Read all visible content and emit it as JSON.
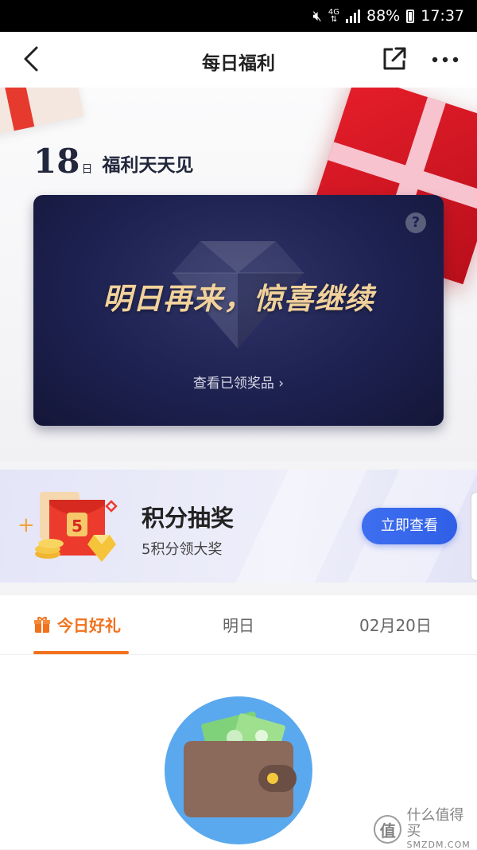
{
  "status_bar": {
    "network": "4G",
    "battery": "88%",
    "time": "17:37"
  },
  "nav": {
    "title": "每日福利"
  },
  "hero": {
    "day": "18",
    "day_unit": "日",
    "slogan": "福利天天见",
    "card": {
      "headline": "明日再来，惊喜继续",
      "help": "?",
      "link": "查看已领奖品"
    }
  },
  "points": {
    "title": "积分抽奖",
    "subtitle": "5积分领大奖",
    "button": "立即查看",
    "envelope_number": "5"
  },
  "tabs": {
    "today": "今日好礼",
    "tomorrow": "明日",
    "later": "02月20日"
  },
  "watermark": {
    "logo": "值",
    "name": "什么值得买",
    "domain": "SMZDM.COM"
  },
  "colors": {
    "accent": "#f2711c",
    "button": "#2f5fe6",
    "card_bg": "#1d2150",
    "headline_gold": "#f2d29b"
  }
}
